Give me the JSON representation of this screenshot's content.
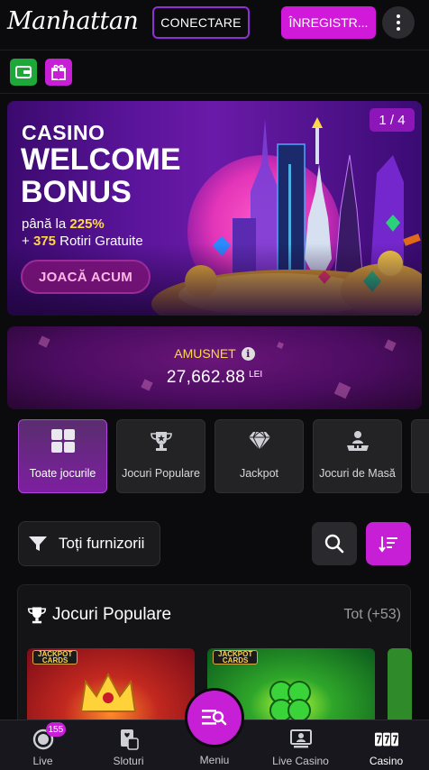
{
  "header": {
    "logo": "Manhattan",
    "login_label": "CONECTARE",
    "register_label": "ÎNREGISTR..."
  },
  "quick_links": [
    {
      "icon": "wallet-icon",
      "color": "#1fa83a"
    },
    {
      "icon": "gift-icon",
      "color": "#c61fd6"
    }
  ],
  "banner": {
    "title1": "CASINO",
    "title2": "WELCOME",
    "title3": "BONUS",
    "line1_prefix": "până la ",
    "line1_value": "225%",
    "line2_prefix": "+ ",
    "line2_value": "375",
    "line2_suffix": " Rotiri Gratuite",
    "cta": "JOACĂ ACUM",
    "page_indicator": "1 / 4"
  },
  "jackpot": {
    "label": "AMUSNET",
    "value": "27,662.88",
    "currency": "LEI"
  },
  "categories": [
    {
      "label": "Toate jocurile",
      "icon": "grid-icon",
      "active": true
    },
    {
      "label": "Jocuri Populare",
      "icon": "trophy-icon",
      "active": false
    },
    {
      "label": "Jackpot",
      "icon": "diamond-icon",
      "active": false
    },
    {
      "label": "Jocuri de Masă",
      "icon": "table-games-icon",
      "active": false
    }
  ],
  "filter": {
    "providers_label": "Toți furnizorii"
  },
  "section": {
    "title": "Jocuri Populare",
    "count": "Tot (+53)",
    "tiles": [
      {
        "badge_line1": "JACKPOT",
        "badge_line2": "CARDS"
      },
      {
        "badge_line1": "JACKPOT",
        "badge_line2": "CARDS"
      }
    ]
  },
  "bottom_nav": {
    "live_label": "Live",
    "live_badge": "155",
    "slots_label": "Sloturi",
    "menu_label": "Meniu",
    "live_casino_label": "Live Casino",
    "casino_label": "Casino"
  },
  "colors": {
    "accent": "#c61fd6",
    "background": "#0b0b0d",
    "gold": "#ffd84a"
  }
}
